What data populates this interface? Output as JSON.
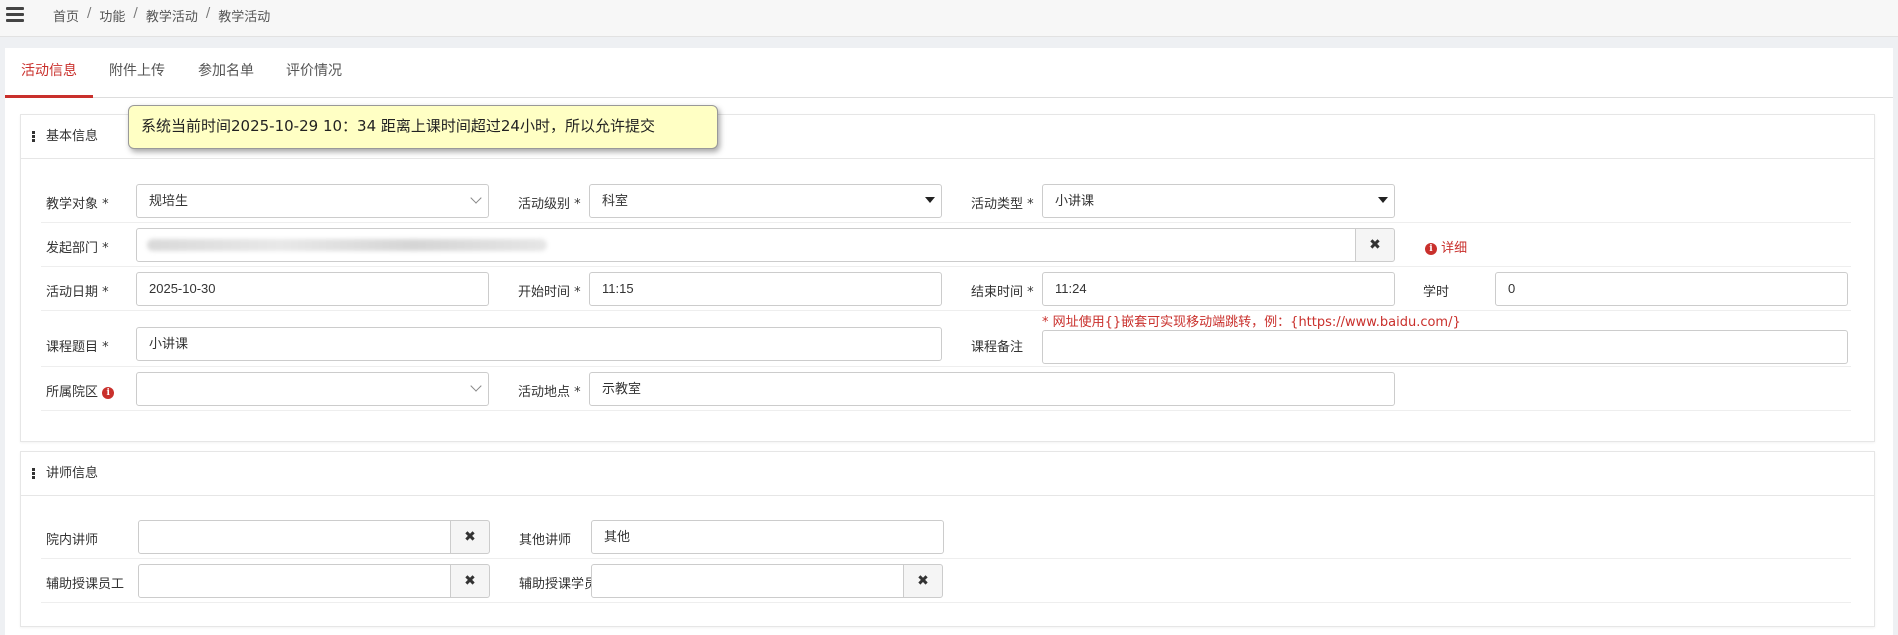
{
  "breadcrumb": [
    "首页",
    "功能",
    "教学活动",
    "教学活动"
  ],
  "tabs": [
    "活动信息",
    "附件上传",
    "参加名单",
    "评价情况"
  ],
  "tooltip": "系统当前时间2025-10-29 10：34 距离上课时间超过24小时，所以允许提交",
  "basic": {
    "title": "基本信息",
    "labels": {
      "target": "教学对象",
      "level": "活动级别",
      "type": "活动类型",
      "dept": "发起部门",
      "detail": "详细",
      "date": "活动日期",
      "start": "开始时间",
      "end": "结束时间",
      "hours": "学时",
      "course": "课程题目",
      "remark": "课程备注",
      "campus": "所属院区",
      "place": "活动地点"
    },
    "values": {
      "target": "规培生",
      "level": "科室",
      "type": "小讲课",
      "date": "2025-10-30",
      "start": "11:15",
      "end": "11:24",
      "hours": "0",
      "course": "小讲课",
      "remark": "",
      "campus": "",
      "place": "示教室"
    },
    "remark_hint": "* 网址使用{}嵌套可实现移动端跳转，例：{https://www.baidu.com/}"
  },
  "teacher": {
    "title": "讲师信息",
    "labels": {
      "inner": "院内讲师",
      "other": "其他讲师",
      "assist_staff": "辅助授课员工",
      "assist_student": "辅助授课学员"
    },
    "values": {
      "inner": "",
      "other": "其他",
      "assist_staff": "",
      "assist_student": ""
    }
  },
  "colors": {
    "accent": "#c9302c",
    "tooltip_bg": "#ffffc4"
  }
}
